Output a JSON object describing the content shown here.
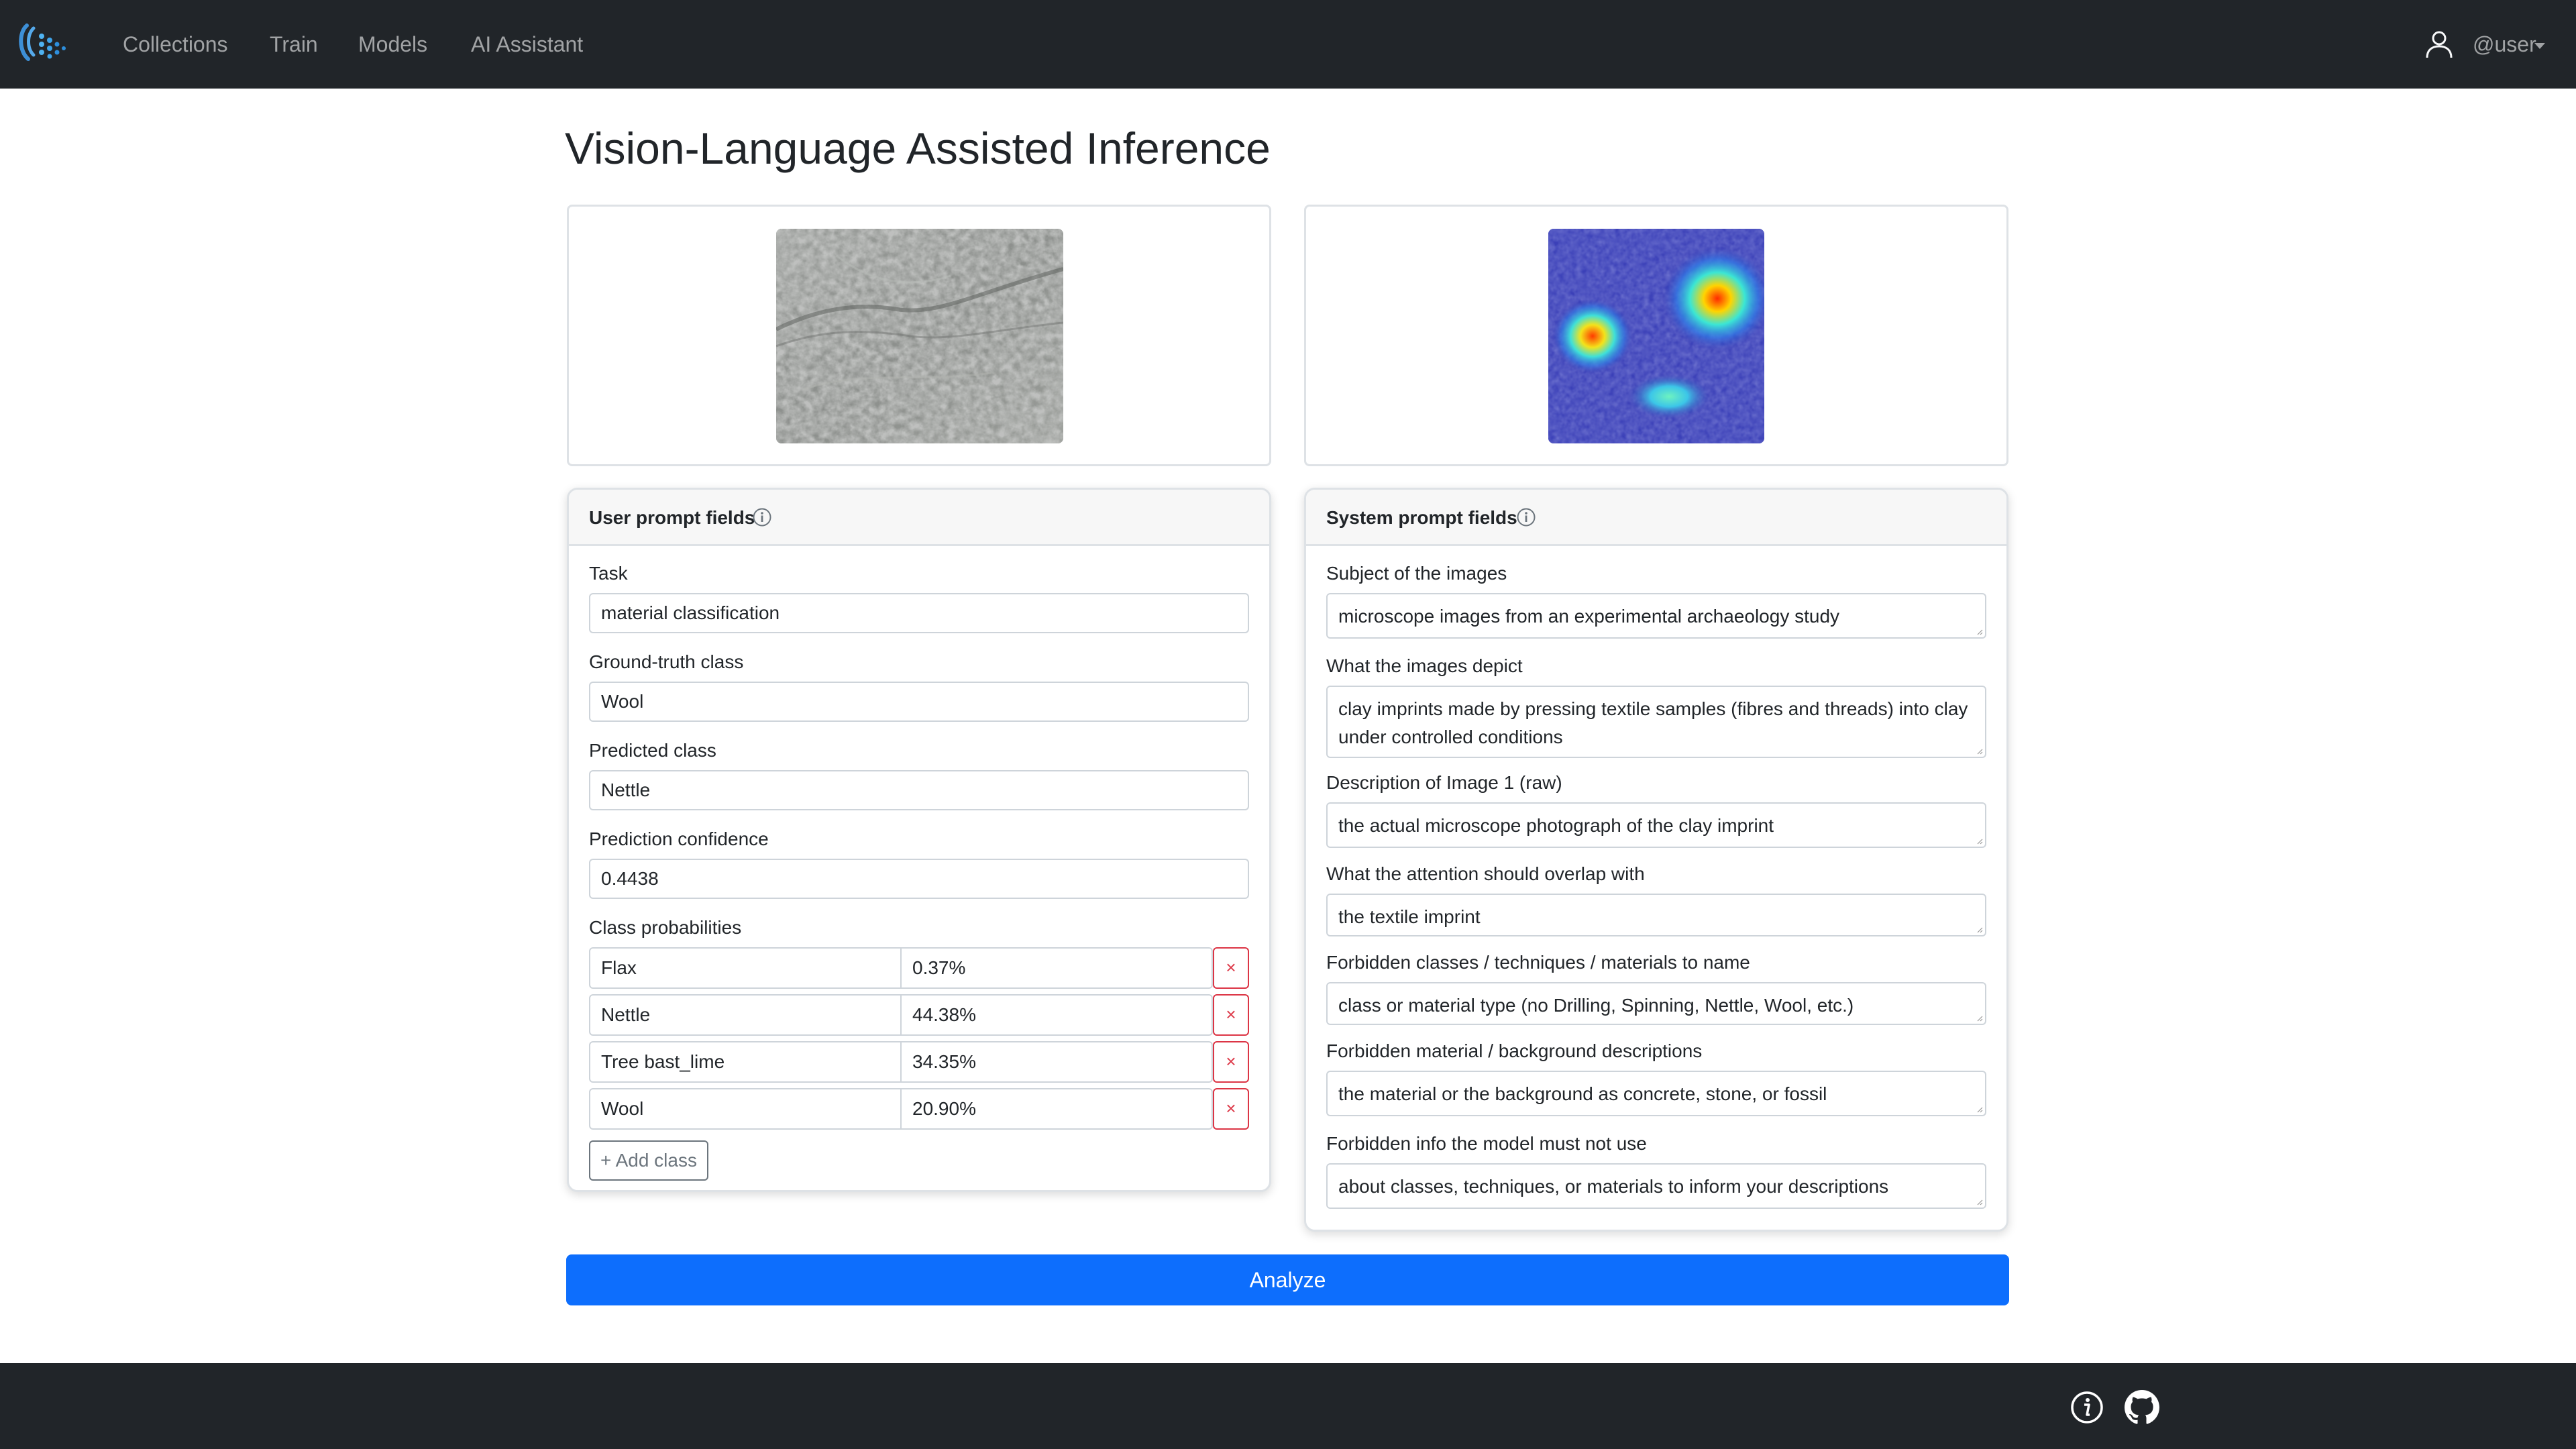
{
  "navbar": {
    "nav_items": [
      "Collections",
      "Train",
      "Models",
      "AI Assistant"
    ],
    "user_label": "@user"
  },
  "page": {
    "title": "Vision-Language Assisted Inference"
  },
  "user_prompt": {
    "header": "User prompt fields",
    "task_label": "Task",
    "task_value": "material classification",
    "ground_truth_label": "Ground-truth class",
    "ground_truth_value": "Wool",
    "predicted_label": "Predicted class",
    "predicted_value": "Nettle",
    "confidence_label": "Prediction confidence",
    "confidence_value": "0.4438",
    "class_probs_label": "Class probabilities",
    "class_probs": [
      {
        "name": "Flax",
        "value": "0.37%"
      },
      {
        "name": "Nettle",
        "value": "44.38%"
      },
      {
        "name": "Tree bast_lime",
        "value": "34.35%"
      },
      {
        "name": "Wool",
        "value": "20.90%"
      }
    ],
    "remove_glyph": "×",
    "add_class_label": "+ Add class"
  },
  "system_prompt": {
    "header": "System prompt fields",
    "fields": [
      {
        "label": "Subject of the images",
        "value": "microscope images from an experimental archaeology study"
      },
      {
        "label": "What the images depict",
        "value": "clay imprints made by pressing textile samples (fibres and threads) into clay under controlled conditions"
      },
      {
        "label": "Description of Image 1 (raw)",
        "value": "the actual microscope photograph of the clay imprint"
      },
      {
        "label": "What the attention should overlap with",
        "value": "the textile imprint"
      },
      {
        "label": "Forbidden classes / techniques / materials to name",
        "value": "class or material type (no Drilling, Spinning, Nettle, Wool, etc.)"
      },
      {
        "label": "Forbidden material / background descriptions",
        "value": "the material or the background as concrete, stone, or fossil"
      },
      {
        "label": "Forbidden info the model must not use",
        "value": "about classes, techniques, or materials to inform your descriptions"
      }
    ]
  },
  "actions": {
    "analyze_label": "Analyze"
  },
  "colors": {
    "navbar_bg": "#212529",
    "primary": "#0d6efd",
    "danger": "#dc3545",
    "border": "#dee2e6",
    "input_border": "#ced4da"
  },
  "icons": [
    "logo-icon",
    "user-icon",
    "caret-down-icon",
    "info-icon",
    "close-icon",
    "info-circle-icon",
    "github-icon"
  ]
}
